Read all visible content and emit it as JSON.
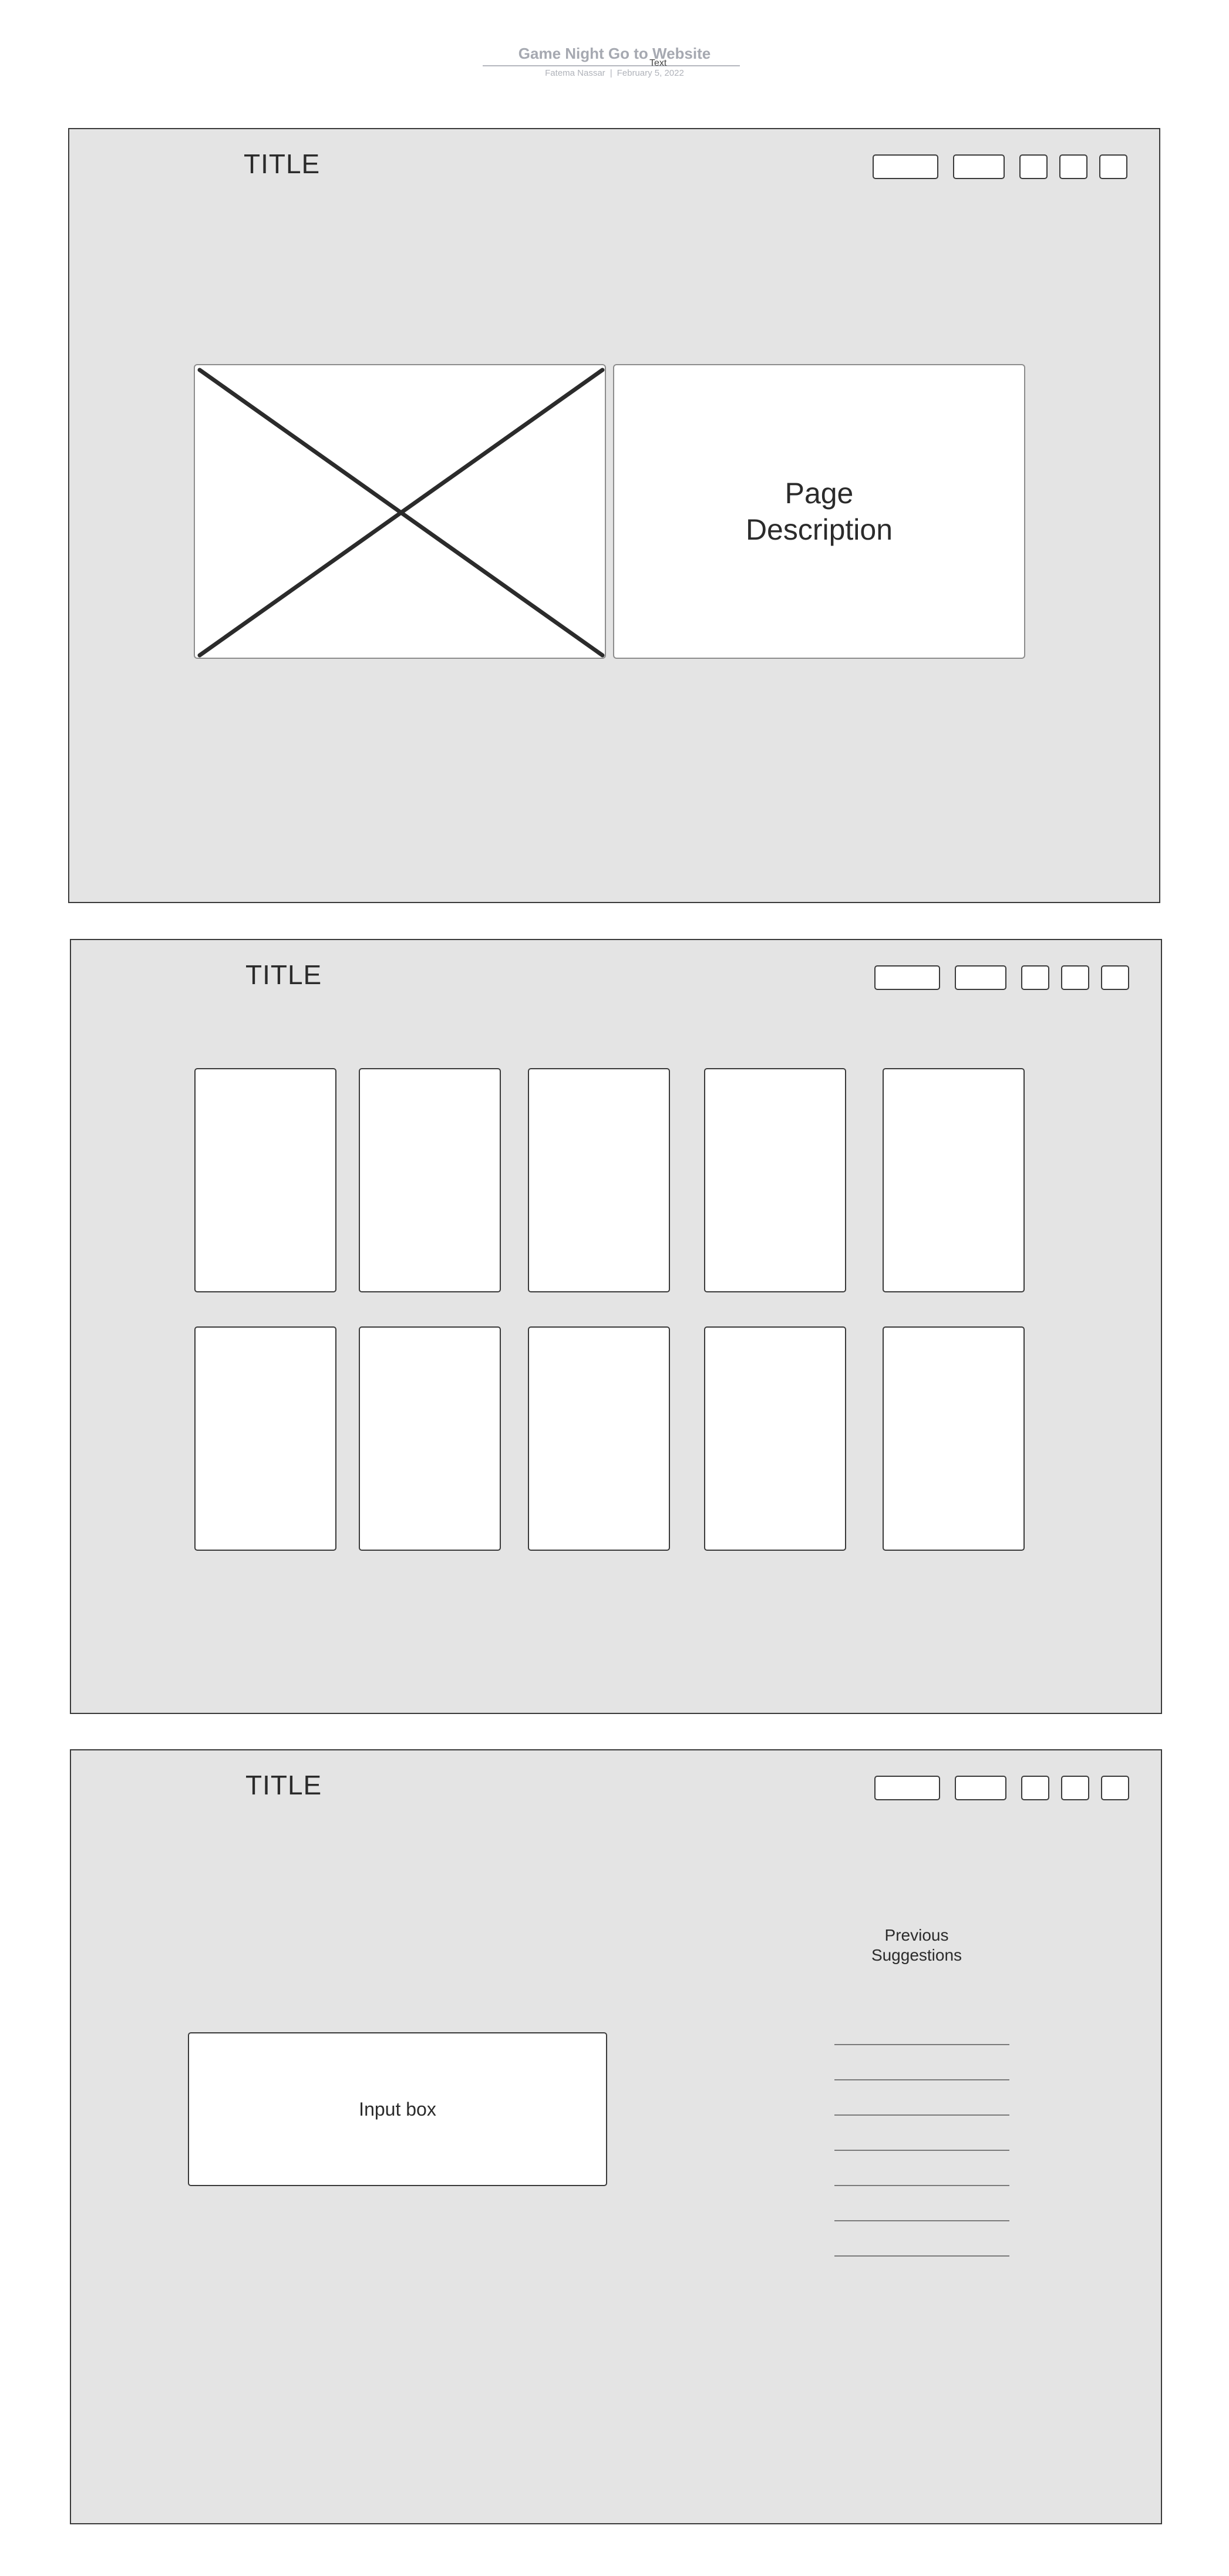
{
  "document": {
    "title": "Game Night Go to Website",
    "text_label": "Text",
    "author": "Fatema Nassar",
    "separator": "|",
    "date": "February 5, 2022"
  },
  "frames": [
    {
      "title": "TITLE",
      "image_placeholder": "crossed-box",
      "description": "Page\nDescription"
    },
    {
      "title": "TITLE",
      "grid": {
        "rows": 2,
        "columns": 5
      }
    },
    {
      "title": "TITLE",
      "input_label": "Input box",
      "previous_heading": "Previous\nSuggestions",
      "suggestion_lines": 7
    }
  ],
  "colors": {
    "frame_fill": "#e4e4e4",
    "frame_border": "#3a3a3a",
    "box_fill": "#ffffff",
    "header_text": "#a6a9b1"
  }
}
